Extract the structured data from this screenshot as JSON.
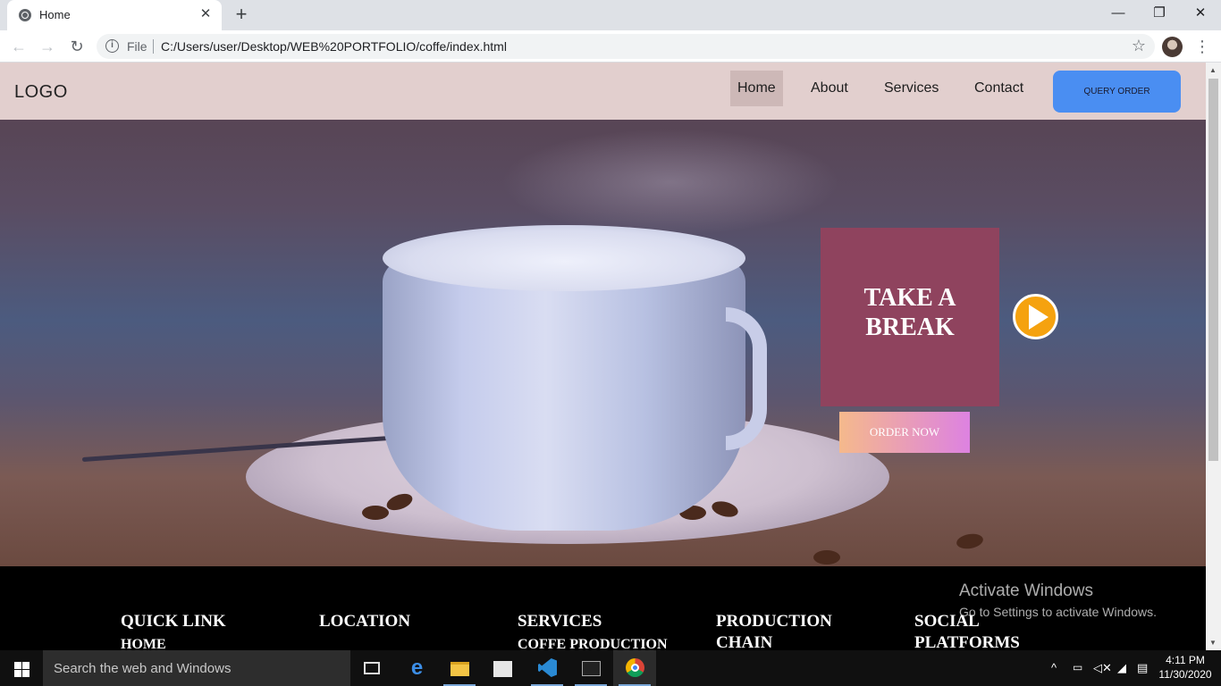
{
  "browser": {
    "tab_title": "Home",
    "address_prefix": "File",
    "url": "C:/Users/user/Desktop/WEB%20PORTFOLIO/coffe/index.html"
  },
  "site": {
    "logo": "LOGO",
    "nav": [
      {
        "label": "Home",
        "active": true
      },
      {
        "label": "About",
        "active": false
      },
      {
        "label": "Services",
        "active": false
      },
      {
        "label": "Contact",
        "active": false
      }
    ],
    "query_button": "QUERY ORDER",
    "hero": {
      "headline": "TAKE A BREAK",
      "order_button": "ORDER NOW"
    },
    "footer": {
      "columns": [
        {
          "title": "QUICK LINK",
          "sub": "HOME"
        },
        {
          "title": "LOCATION",
          "sub": ""
        },
        {
          "title": "SERVICES",
          "sub": "COFFE PRODUCTION"
        },
        {
          "title": "PRODUCTION CHAIN",
          "sub": ""
        },
        {
          "title": "SOCIAL PLATFORMS",
          "sub": ""
        }
      ]
    }
  },
  "watermark": {
    "line1": "Activate Windows",
    "line2": "Go to Settings to activate Windows."
  },
  "taskbar": {
    "search_placeholder": "Search the web and Windows",
    "time": "4:11 PM",
    "date": "11/30/2020"
  },
  "colors": {
    "navbar_bg": "#e2cfce",
    "query_button": "#4a8ef2",
    "break_box": "#8f435e",
    "play_button": "#f5a20f",
    "footer_bg": "#000000"
  }
}
